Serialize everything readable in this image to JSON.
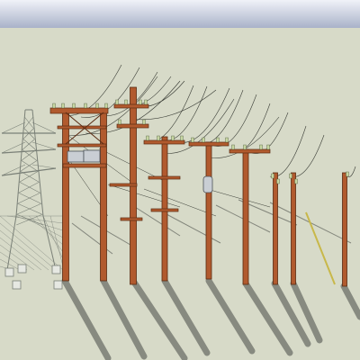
{
  "window": {
    "title": ""
  },
  "viewport": {
    "background": "#d7dac8",
    "sky_top": "#f0f2f8",
    "sky_bottom": "#a9b2c9",
    "pole_color": "#b15a2e",
    "pole_outline": "#5a2b12",
    "tower_color": "#7a8077",
    "wire_color": "#3a3d36",
    "shadow_color": "#6d7068",
    "transformer_color": "#c9ced4",
    "glass_insulator_color": "#c7d6a2"
  },
  "scene": {
    "objects": [
      "lattice-transmission-tower",
      "h-frame-transformer-pole",
      "tall-double-crossarm-pole",
      "double-crossarm-pole",
      "single-crossarm-transformer-pole",
      "single-crossarm-pole",
      "bracket-pole",
      "bracket-pole",
      "bracket-pole-with-guy-wire"
    ]
  }
}
